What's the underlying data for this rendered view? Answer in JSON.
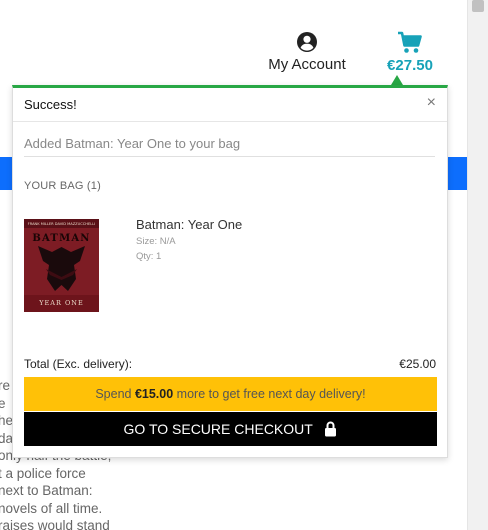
{
  "header": {
    "account_label": "My Account",
    "account_icon": "user-circle-icon",
    "cart_icon": "shopping-cart-icon",
    "cart_total": "€27.50",
    "accent_color": "#17a2b8",
    "success_color": "#28a745"
  },
  "popover": {
    "title": "Success!",
    "close_label": "×",
    "message": "Added Batman: Year One to your bag",
    "bag_heading": "YOUR BAG (1)",
    "item": {
      "title": "Batman: Year One",
      "size": "Size: N/A",
      "qty": "Qty: 1",
      "cover_top_text": "FRANK MILLER  DAVID MAZZUCCHELLI",
      "cover_title": "BATMAN",
      "cover_subtitle": "YEAR ONE"
    },
    "total_label": "Total (Exc. delivery):",
    "total_value": "€25.00",
    "delivery_prefix": "Spend ",
    "delivery_amount": "€15.00",
    "delivery_suffix": " more to get free next day delivery!",
    "delivery_color": "#ffc107",
    "checkout_label": "GO TO SECURE CHECKOUT",
    "checkout_icon": "lock-icon"
  },
  "background_text": [
    "re",
    "e",
    "he",
    "da",
    "only half the battle;",
    "t a police force",
    "next to Batman:",
    "novels of all time.",
    "raises would stand"
  ]
}
